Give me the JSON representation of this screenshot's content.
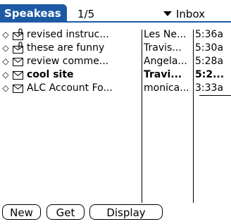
{
  "app": {
    "title": "Speakeas",
    "page_counter": "1/5",
    "category": "Inbox"
  },
  "messages": [
    {
      "subject": "revised instruc...",
      "from": "Les Ne...",
      "time": "5:36a",
      "icon": "mail-attachment-icon",
      "bold": false
    },
    {
      "subject": "these are funny",
      "from": "Travis...",
      "time": "5:30a",
      "icon": "mail-attachment-icon",
      "bold": false
    },
    {
      "subject": "review comme...",
      "from": "Angela...",
      "time": "5:28a",
      "icon": "mail-icon",
      "bold": false
    },
    {
      "subject": "cool site",
      "from": "Travi...",
      "time": "5:2...",
      "icon": "mail-icon",
      "bold": true
    },
    {
      "subject": "ALC Account Fo...",
      "from": "monica...",
      "time": "3:33a",
      "icon": "mail-icon",
      "bold": false
    }
  ],
  "buttons": {
    "new": "New",
    "get": "Get",
    "display": "Display"
  },
  "colors": {
    "accent": "#1e5aa3"
  }
}
